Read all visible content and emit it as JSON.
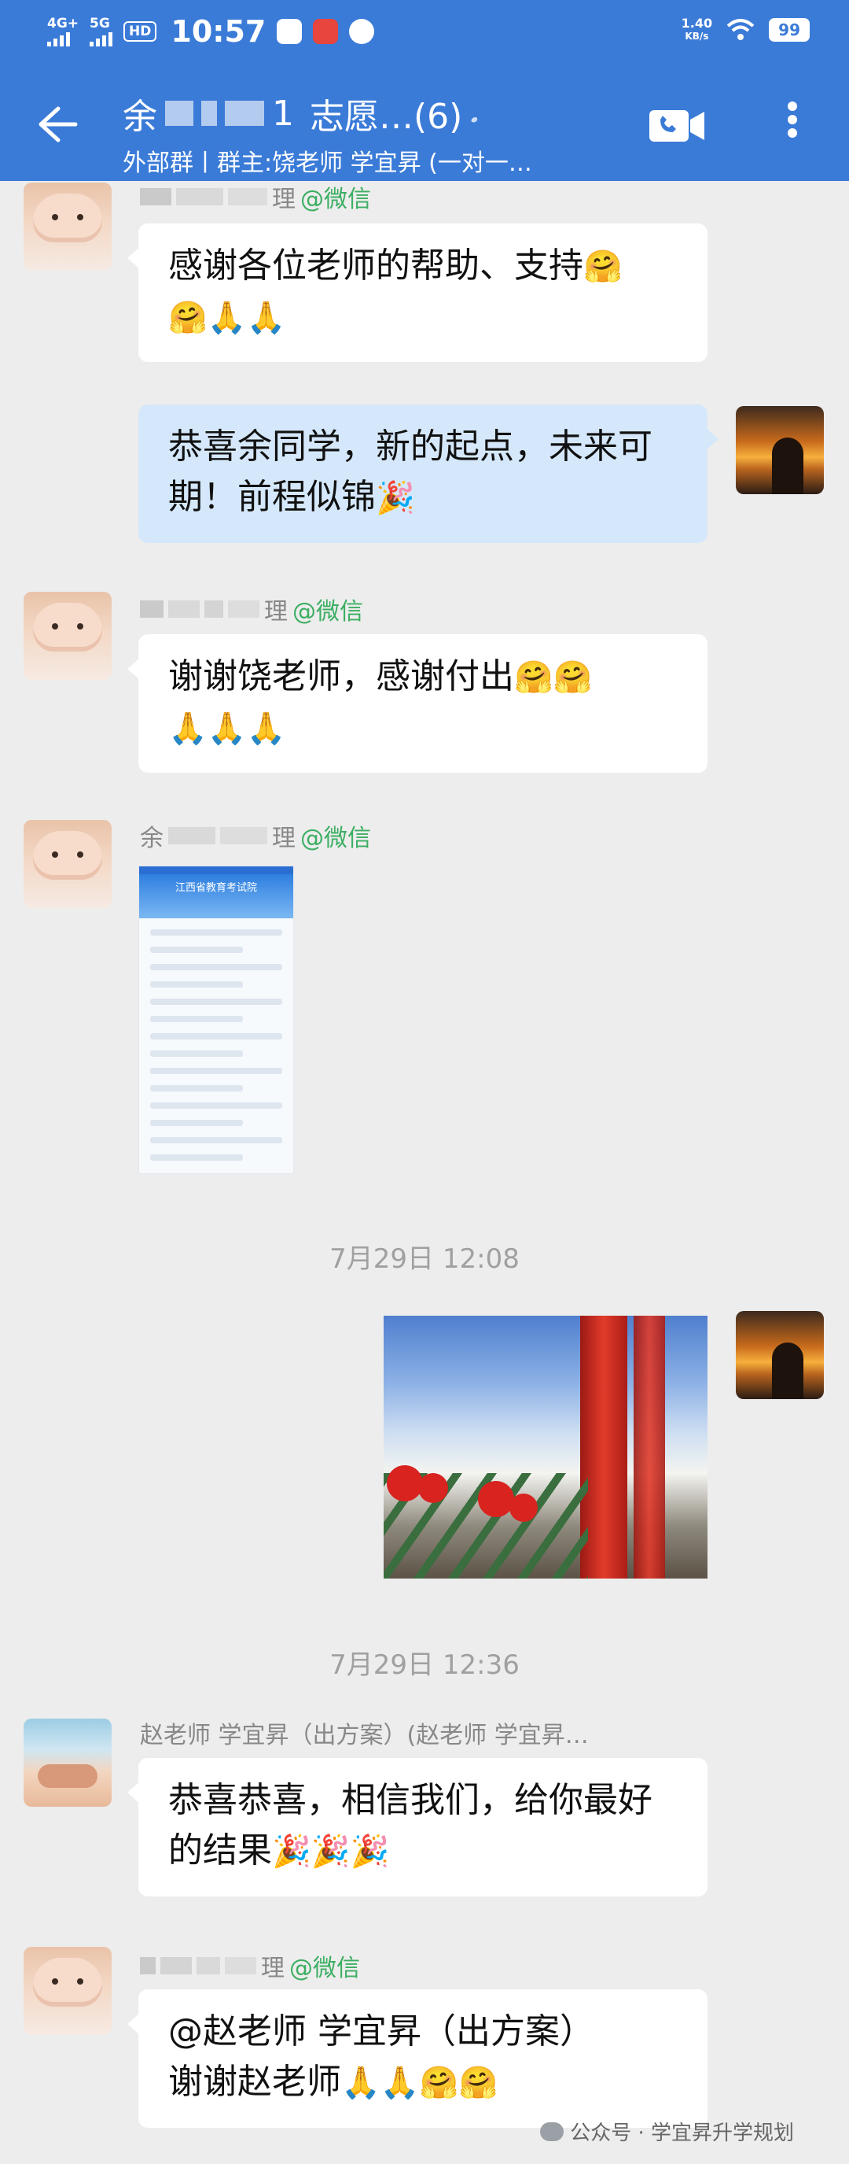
{
  "status_bar": {
    "network_1": "4G+",
    "network_2": "5G",
    "hd": "HD",
    "time": "10:57",
    "speed_value": "1.40",
    "speed_unit": "KB/s",
    "battery": "99"
  },
  "header": {
    "title_prefix": "余",
    "title_middle": "1",
    "title_main": "志愿…(6)",
    "subtitle": "外部群丨群主:饶老师 学宜昇 (一对一…"
  },
  "messages": [
    {
      "sender_suffix": "理",
      "source": "@微信",
      "text": "感谢各位老师的帮助、支持"
    },
    {
      "text": "恭喜余同学，新的起点，未来可期！前程似锦"
    },
    {
      "sender_suffix": "理",
      "source": "@微信",
      "text": "谢谢饶老师，感谢付出"
    },
    {
      "sender_prefix": "余",
      "sender_suffix": "理",
      "source": "@微信",
      "image_title": "江西省教育考试院"
    },
    {
      "timestamp": "7月29日 12:08"
    },
    {
      "timestamp": "7月29日 12:36"
    },
    {
      "sender": "赵老师 学宜昇（出方案）(赵老师 学宜昇…",
      "text": "恭喜恭喜，相信我们，给你最好的结果"
    },
    {
      "sender_suffix": "理",
      "source": "@微信",
      "text_line1": "@赵老师 学宜昇（出方案）",
      "text_line2": "谢谢赵老师"
    }
  ],
  "watermark": "公众号 · 学宜昇升学规划",
  "colors": {
    "header_blue": "#3b7bd8",
    "wechat_green": "#3cae62",
    "my_bubble": "#d5e8fb"
  }
}
